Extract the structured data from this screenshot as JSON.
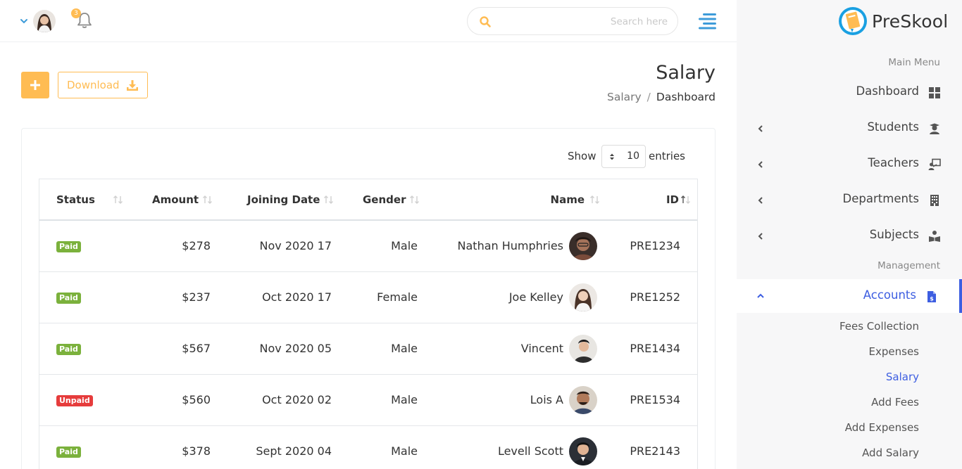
{
  "header": {
    "notification_count": "3",
    "search_placeholder": "Search here"
  },
  "page": {
    "title": "Salary",
    "breadcrumb": [
      "Salary",
      "/",
      "Dashboard"
    ],
    "add_icon": "plus-icon",
    "download_label": "Download"
  },
  "table": {
    "show_label": "Show",
    "entries_value": "10",
    "entries_label": "entries",
    "columns": [
      "Status",
      "Amount",
      "Joining Date",
      "Gender",
      "Name",
      "ID"
    ],
    "rows": [
      {
        "status": "Paid",
        "amount": "$278",
        "date": "Nov 2020 17",
        "gender": "Male",
        "name": "Nathan Humphries",
        "id": "PRE1234"
      },
      {
        "status": "Paid",
        "amount": "$237",
        "date": "Oct 2020 17",
        "gender": "Female",
        "name": "Joe Kelley",
        "id": "PRE1252"
      },
      {
        "status": "Paid",
        "amount": "$567",
        "date": "Nov 2020 05",
        "gender": "Male",
        "name": "Vincent",
        "id": "PRE1434"
      },
      {
        "status": "Unpaid",
        "amount": "$560",
        "date": "Oct 2020 02",
        "gender": "Male",
        "name": "Lois A",
        "id": "PRE1534"
      },
      {
        "status": "Paid",
        "amount": "$378",
        "date": "Sept 2020 04",
        "gender": "Male",
        "name": "Levell Scott",
        "id": "PRE2143"
      }
    ]
  },
  "sidebar": {
    "brand": "PreSkool",
    "main_menu_title": "Main Menu",
    "management_title": "Management",
    "items": [
      {
        "label": "Dashboard",
        "icon": "dashboard-grid-icon"
      },
      {
        "label": "Students",
        "icon": "graduate-icon"
      },
      {
        "label": "Teachers",
        "icon": "teacher-board-icon"
      },
      {
        "label": "Departments",
        "icon": "building-icon"
      },
      {
        "label": "Subjects",
        "icon": "book-reader-icon"
      }
    ],
    "accounts": {
      "label": "Accounts",
      "icon": "invoice-icon"
    },
    "account_subitems": [
      "Fees Collection",
      "Expenses",
      "Salary",
      "Add Fees",
      "Add Expenses",
      "Add Salary"
    ]
  },
  "colors": {
    "accent_yellow": "#ffbc53",
    "primary_blue": "#3d5ee1",
    "sidebar_bg": "#f7f7f8",
    "paid_green": "#7bb13c",
    "unpaid_red": "#e63c3c"
  }
}
